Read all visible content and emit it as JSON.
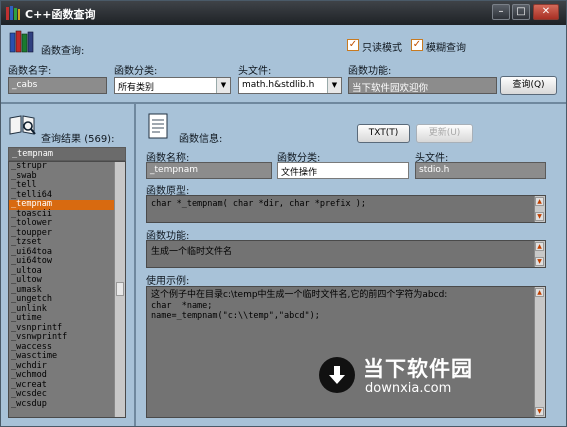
{
  "window": {
    "title": "C++函数查询"
  },
  "search": {
    "heading": "函数查询:",
    "readonly_label": "只读模式",
    "fuzzy_label": "模糊查询",
    "name_label": "函数名字:",
    "name_value": "_cabs",
    "category_label": "函数分类:",
    "category_value": "所有类别",
    "header_label": "头文件:",
    "header_value": "math.h&stdlib.h",
    "feature_label": "函数功能:",
    "feature_value": "当下软件园欢迎你",
    "query_button": "查询(Q)"
  },
  "results": {
    "heading": "查询结果",
    "count": "(569)",
    "colon": ":",
    "filter_value": "_tempnam",
    "items": [
      "_strupr",
      "_swab",
      "_tell",
      "_telli64",
      "_tempnam",
      "_toascii",
      "_tolower",
      "_toupper",
      "_tzset",
      "_ui64toa",
      "_ui64tow",
      "_ultoa",
      "_ultow",
      "_umask",
      "_ungetch",
      "_unlink",
      "_utime",
      "_vsnprintf",
      "_vsnwprintf",
      "_waccess",
      "_wasctime",
      "_wchdir",
      "_wchmod",
      "_wcreat",
      "_wcsdec",
      "_wcsdup"
    ],
    "selected_index": 4
  },
  "info": {
    "heading": "函数信息:",
    "txt_button": "TXT(T)",
    "update_button": "更新(U)",
    "name_label": "函数名称:",
    "name_value": "_tempnam",
    "category_label": "函数分类:",
    "category_value": "文件操作",
    "header_label": "头文件:",
    "header_value": "stdio.h",
    "prototype_label": "函数原型:",
    "prototype_value": "char *_tempnam( char *dir, char *prefix );",
    "feature_label": "函数功能:",
    "feature_value": "生成一个临时文件名",
    "example_label": "使用示例:",
    "example_lines": [
      "这个例子中在目录c:\\temp中生成一个临时文件名,它的前四个字符为abcd:",
      "char  *name;",
      "name=_tempnam(\"c:\\\\temp\",\"abcd\");"
    ]
  },
  "watermark": {
    "title": "当下软件园",
    "url": "downxia.com"
  }
}
